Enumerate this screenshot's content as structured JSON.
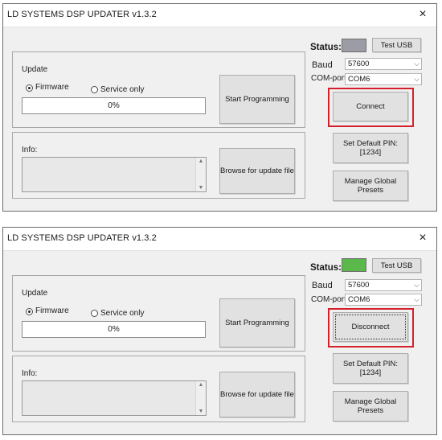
{
  "colors": {
    "status_gray": "#9c9ca6",
    "status_green": "#5bb84a",
    "highlight": "#d4202a"
  },
  "windows": [
    {
      "title": "LD SYSTEMS DSP UPDATER v1.3.2",
      "close_icon": "×",
      "update_label": "Update",
      "firmware_label": "Firmware",
      "firmware_selected": true,
      "service_only_label": "Service only",
      "progress_text": "0%",
      "progress_value": 0,
      "start_programming_label": "Start Programming",
      "info_label": "Info:",
      "browse_label": "Browse for update file",
      "status_label": "Status:",
      "status_color": "#9c9ca6",
      "test_usb_label": "Test USB",
      "baud_label": "Baud",
      "baud_value": "57600",
      "com_port_label": "COM-port",
      "com_port_value": "COM6",
      "connect_button_label": "Connect",
      "set_pin_label": "Set Default PIN:[1234]",
      "manage_presets_label": "Manage Global Presets"
    },
    {
      "title": "LD SYSTEMS DSP UPDATER v1.3.2",
      "close_icon": "×",
      "update_label": "Update",
      "firmware_label": "Firmware",
      "firmware_selected": true,
      "service_only_label": "Service only",
      "progress_text": "0%",
      "progress_value": 0,
      "start_programming_label": "Start Programming",
      "info_label": "Info:",
      "browse_label": "Browse for update file",
      "status_label": "Status:",
      "status_color": "#5bb84a",
      "test_usb_label": "Test USB",
      "baud_label": "Baud",
      "baud_value": "57600",
      "com_port_label": "COM-port",
      "com_port_value": "COM6",
      "connect_button_label": "Disconnect",
      "set_pin_label": "Set Default PIN:[1234]",
      "manage_presets_label": "Manage Global Presets"
    }
  ]
}
